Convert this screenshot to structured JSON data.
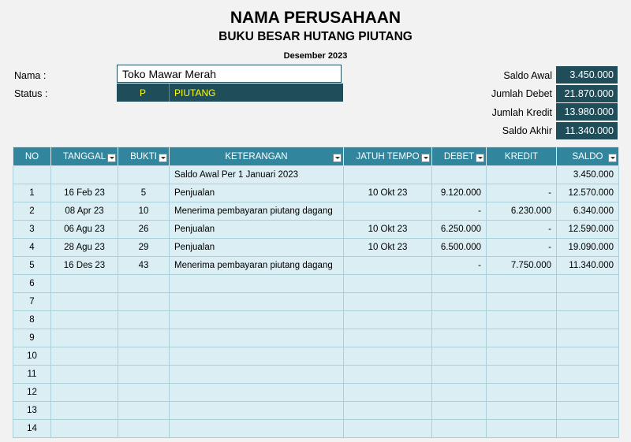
{
  "header": {
    "company": "NAMA PERUSAHAAN",
    "book_title": "BUKU BESAR HUTANG PIUTANG",
    "period": "Desember 2023"
  },
  "account": {
    "name_label": "Nama  :",
    "name_value": "Toko Mawar Merah",
    "status_label": "Status  :",
    "status_code": "P",
    "status_text": "PIUTANG"
  },
  "summary": {
    "saldo_awal_label": "Saldo Awal",
    "saldo_awal": "3.450.000",
    "jumlah_debet_label": "Jumlah Debet",
    "jumlah_debet": "21.870.000",
    "jumlah_kredit_label": "Jumlah Kredit",
    "jumlah_kredit": "13.980.000",
    "saldo_akhir_label": "Saldo Akhir",
    "saldo_akhir": "11.340.000"
  },
  "table": {
    "columns": [
      "NO",
      "TANGGAL",
      "BUKTI",
      "KETERANGAN",
      "JATUH TEMPO",
      "DEBET",
      "KREDIT",
      "SALDO"
    ],
    "opening_row": {
      "keterangan": "Saldo Awal Per 1 Januari 2023",
      "saldo": "3.450.000"
    },
    "rows": [
      {
        "no": "1",
        "tanggal": "16 Feb 23",
        "bukti": "5",
        "keterangan": "Penjualan",
        "jatuh_tempo": "10 Okt 23",
        "debet": "9.120.000",
        "kredit": "-",
        "saldo": "12.570.000"
      },
      {
        "no": "2",
        "tanggal": "08 Apr 23",
        "bukti": "10",
        "keterangan": "Menerima pembayaran piutang dagang",
        "jatuh_tempo": "",
        "debet": "-",
        "kredit": "6.230.000",
        "saldo": "6.340.000"
      },
      {
        "no": "3",
        "tanggal": "06 Agu 23",
        "bukti": "26",
        "keterangan": "Penjualan",
        "jatuh_tempo": "10 Okt 23",
        "debet": "6.250.000",
        "kredit": "-",
        "saldo": "12.590.000"
      },
      {
        "no": "4",
        "tanggal": "28 Agu 23",
        "bukti": "29",
        "keterangan": "Penjualan",
        "jatuh_tempo": "10 Okt 23",
        "debet": "6.500.000",
        "kredit": "-",
        "saldo": "19.090.000"
      },
      {
        "no": "5",
        "tanggal": "16 Des 23",
        "bukti": "43",
        "keterangan": "Menerima pembayaran piutang dagang",
        "jatuh_tempo": "",
        "debet": "-",
        "kredit": "7.750.000",
        "saldo": "11.340.000"
      },
      {
        "no": "6",
        "tanggal": "",
        "bukti": "",
        "keterangan": "",
        "jatuh_tempo": "",
        "debet": "",
        "kredit": "",
        "saldo": ""
      },
      {
        "no": "7",
        "tanggal": "",
        "bukti": "",
        "keterangan": "",
        "jatuh_tempo": "",
        "debet": "",
        "kredit": "",
        "saldo": ""
      },
      {
        "no": "8",
        "tanggal": "",
        "bukti": "",
        "keterangan": "",
        "jatuh_tempo": "",
        "debet": "",
        "kredit": "",
        "saldo": ""
      },
      {
        "no": "9",
        "tanggal": "",
        "bukti": "",
        "keterangan": "",
        "jatuh_tempo": "",
        "debet": "",
        "kredit": "",
        "saldo": ""
      },
      {
        "no": "10",
        "tanggal": "",
        "bukti": "",
        "keterangan": "",
        "jatuh_tempo": "",
        "debet": "",
        "kredit": "",
        "saldo": ""
      },
      {
        "no": "11",
        "tanggal": "",
        "bukti": "",
        "keterangan": "",
        "jatuh_tempo": "",
        "debet": "",
        "kredit": "",
        "saldo": ""
      },
      {
        "no": "12",
        "tanggal": "",
        "bukti": "",
        "keterangan": "",
        "jatuh_tempo": "",
        "debet": "",
        "kredit": "",
        "saldo": ""
      },
      {
        "no": "13",
        "tanggal": "",
        "bukti": "",
        "keterangan": "",
        "jatuh_tempo": "",
        "debet": "",
        "kredit": "",
        "saldo": ""
      },
      {
        "no": "14",
        "tanggal": "",
        "bukti": "",
        "keterangan": "",
        "jatuh_tempo": "",
        "debet": "",
        "kredit": "",
        "saldo": ""
      }
    ]
  },
  "icons": {
    "filter": "dropdown-filter-icon"
  },
  "colors": {
    "header_bg": "#31859c",
    "dark_cell": "#1f4e5a",
    "row_bg": "#daeef3",
    "status_text": "#ffff00"
  }
}
